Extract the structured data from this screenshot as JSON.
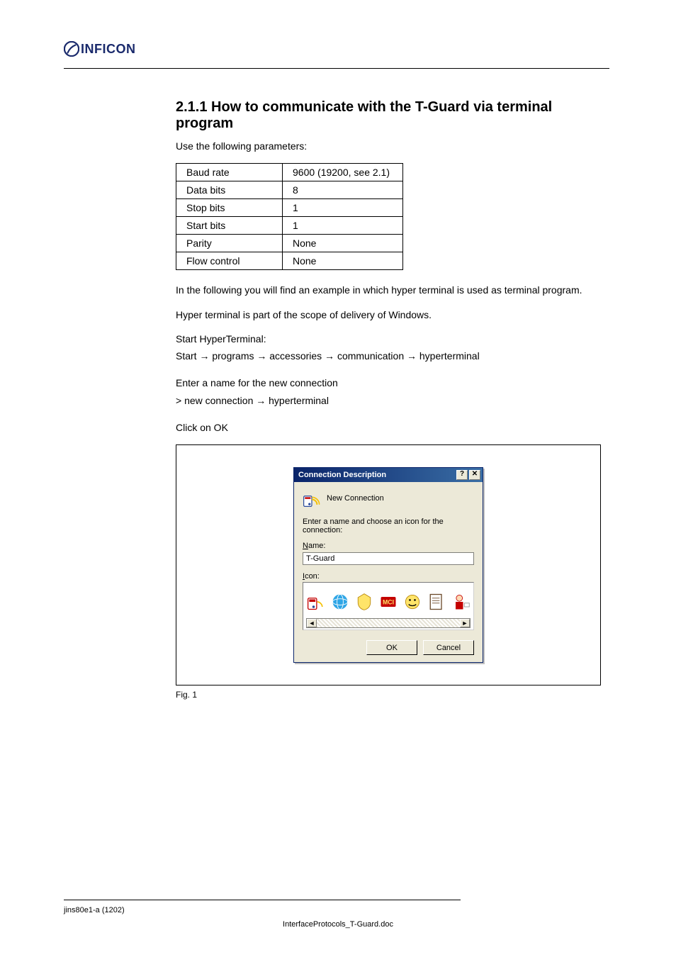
{
  "logo": {
    "text": "INFICON"
  },
  "section": {
    "num": "2.1.1",
    "title": "How to communicate with the T-Guard via terminal program",
    "intro": "Use the following parameters:"
  },
  "spec_table": [
    {
      "name": "Baud rate",
      "value": "9600 (19200, see 2.1)"
    },
    {
      "name": "Data bits",
      "value": "8"
    },
    {
      "name": "Stop bits",
      "value": "1"
    },
    {
      "name": "Start bits",
      "value": "1"
    },
    {
      "name": "Parity",
      "value": "None"
    },
    {
      "name": "Flow control",
      "value": "None"
    }
  ],
  "example": {
    "intro": "In the following you will find an example in which hyper terminal is used as terminal program.",
    "note": "Hyper terminal is part of the scope of delivery of Windows.",
    "start_ht": "Start HyperTerminal:",
    "path_line1": "Start → programs → accessories → communication → hyperterminal",
    "enter_name": "Enter a name for the new connection",
    "path_line2": "     > new connection → hyperterminal",
    "click_ok": "Click on OK"
  },
  "dialog": {
    "title": "Connection Description",
    "subtitle": "New Connection",
    "prompt": "Enter a name and choose an icon for the connection:",
    "name_label_pre": "N",
    "name_label_rest": "ame:",
    "name_value": "T-Guard",
    "icon_label_pre": "I",
    "icon_label_rest": "con:",
    "ok": "OK",
    "cancel": "Cancel",
    "help": "?",
    "close": "✕"
  },
  "figure_caption": "Fig. 1",
  "footer": {
    "left": "jins80e1-a   (1202)",
    "center": "InterfaceProtocols_T-Guard.doc"
  }
}
